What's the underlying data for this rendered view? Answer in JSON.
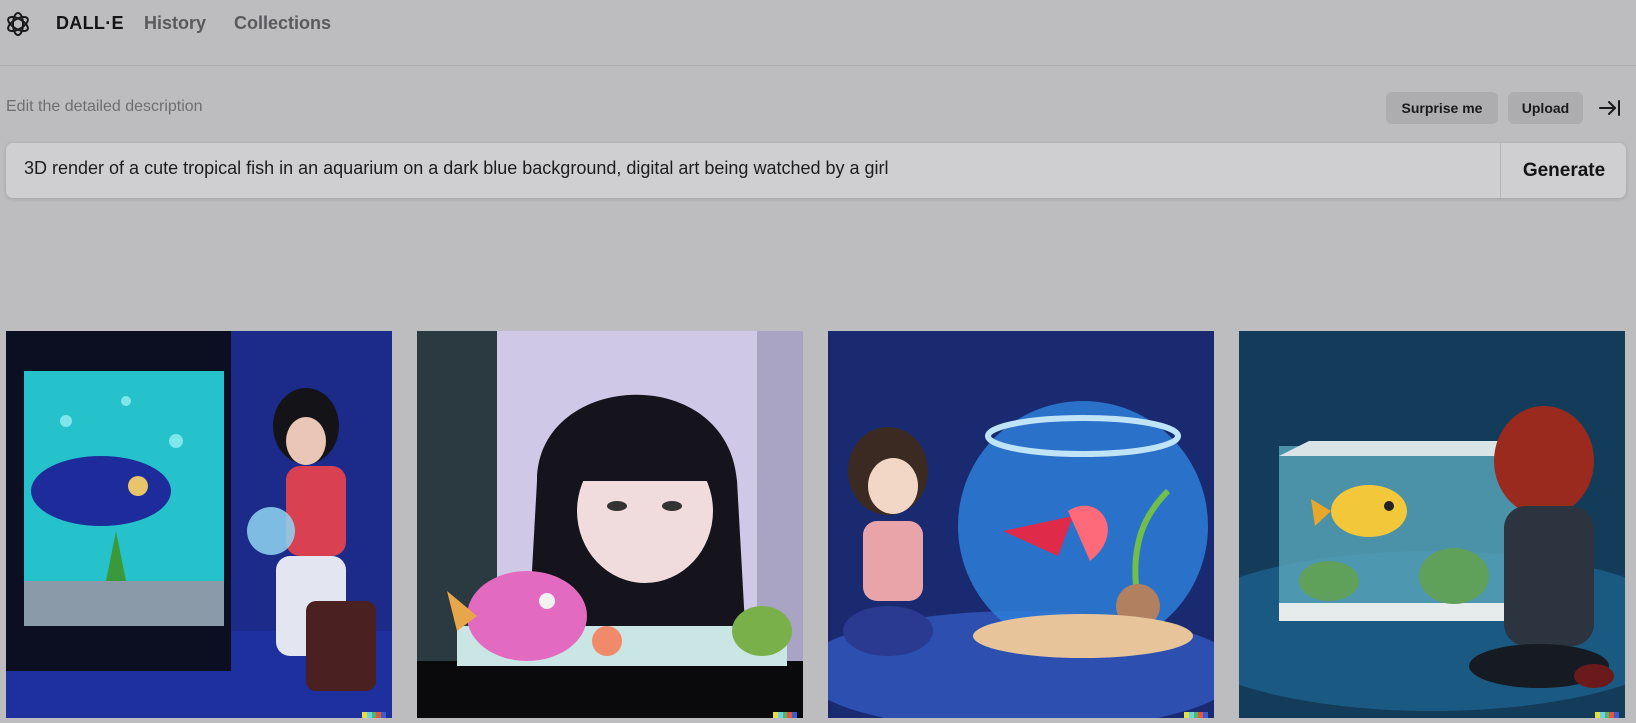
{
  "nav": {
    "brand": "DALL·E",
    "history": "History",
    "collections": "Collections"
  },
  "editor": {
    "label": "Edit the detailed description",
    "surprise_label": "Surprise me",
    "upload_label": "Upload",
    "prompt_value": "3D render of a cute tropical fish in an aquarium on a dark blue background, digital art being watched by a girl",
    "generate_label": "Generate"
  },
  "results": [
    {
      "description": "girl in red top sitting beside a large fish tank holding a glass bowl"
    },
    {
      "description": "girl with dark bob haircut looking down at a pink fish in a tank"
    },
    {
      "description": "girl kneeling next to a round fishbowl with a red fish and a plant"
    },
    {
      "description": "girl with red hair seen from behind watching a yellow fish in a tank"
    }
  ],
  "signature_colors": [
    "#e8e03a",
    "#6bd3e6",
    "#4fb86a",
    "#e8553d",
    "#3a5fcf"
  ],
  "icons": {
    "logo": "openai-logo-icon",
    "collapse": "collapse-sidebar-icon"
  }
}
